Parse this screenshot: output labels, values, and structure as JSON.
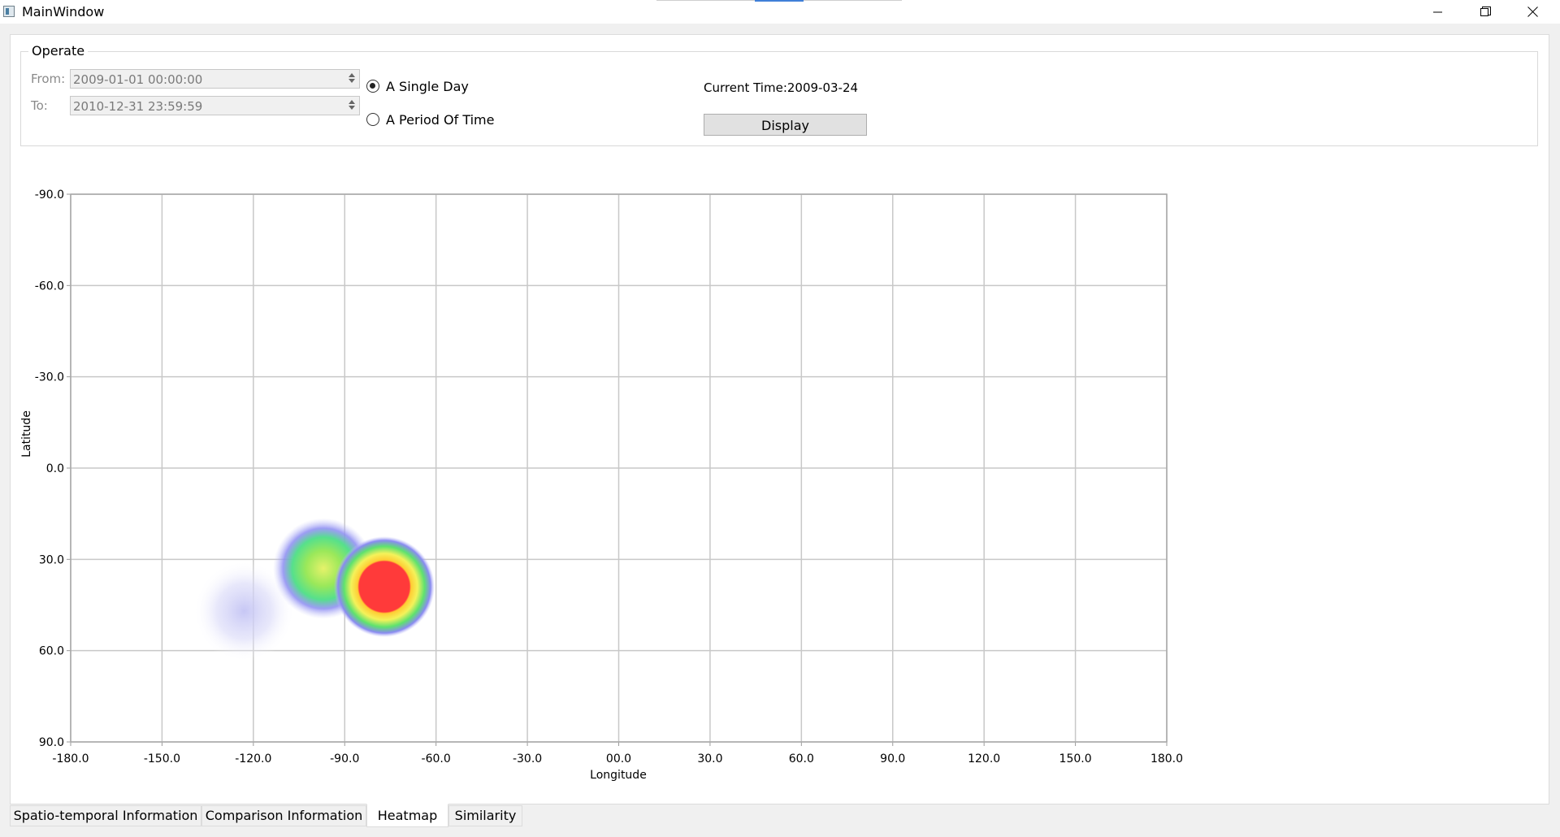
{
  "window": {
    "title": "MainWindow"
  },
  "operate": {
    "group_title": "Operate",
    "from_label": "From:",
    "from_value": "2009-01-01 00:00:00",
    "to_label": "To:",
    "to_value": "2010-12-31 23:59:59",
    "radio_single_day": "A Single Day",
    "radio_period": "A Period Of Time",
    "selected_mode": "A Single Day",
    "current_time": "Current Time:2009-03-24",
    "display_button": "Display"
  },
  "chart_data": {
    "type": "heatmap",
    "xlabel": "Longitude",
    "ylabel": "Latitude",
    "xlim": [
      -180,
      180
    ],
    "ylim": [
      -90,
      90
    ],
    "y_axis_inverted": true,
    "grid": true,
    "x_ticks": [
      "-180.0",
      "-150.0",
      "-120.0",
      "-90.0",
      "-60.0",
      "-30.0",
      "00.0",
      "30.0",
      "60.0",
      "90.0",
      "120.0",
      "150.0",
      "180.0"
    ],
    "y_ticks": [
      "-90.0",
      "-60.0",
      "-30.0",
      "0.0",
      "30.0",
      "60.0",
      "90.0"
    ],
    "points": [
      {
        "lon": -123,
        "lat": 47,
        "intensity": 0.12
      },
      {
        "lon": -97,
        "lat": 33,
        "intensity": 0.55
      },
      {
        "lon": -77,
        "lat": 39,
        "intensity": 1.0
      }
    ]
  },
  "tabs": [
    {
      "label": "Spatio-temporal Information",
      "active": false
    },
    {
      "label": "Comparison Information",
      "active": false
    },
    {
      "label": "Heatmap",
      "active": true
    },
    {
      "label": "Similarity",
      "active": false
    }
  ]
}
